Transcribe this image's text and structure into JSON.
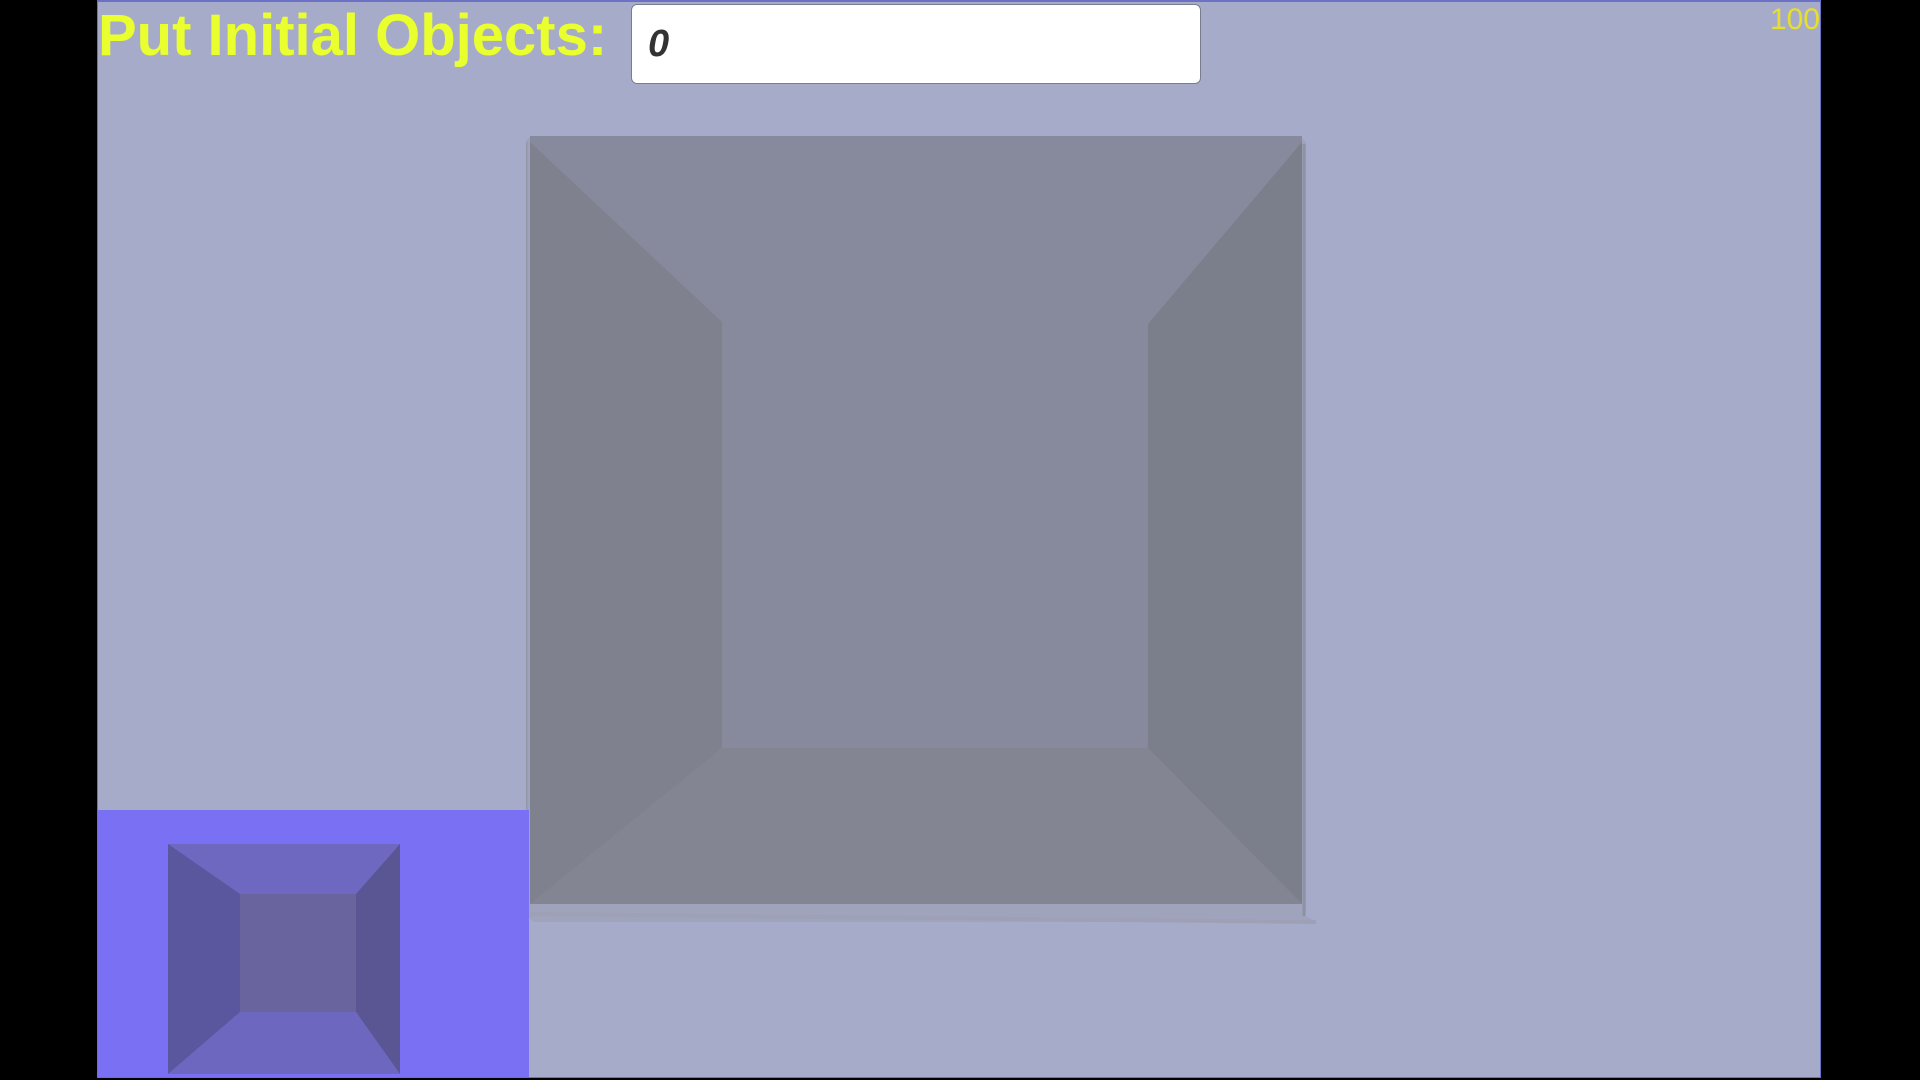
{
  "prompt": {
    "label": "Put Initial Objects:",
    "input_value": "0"
  },
  "hud": {
    "score": "100"
  },
  "colors": {
    "background": "#a7abca",
    "label": "#e9ff2e",
    "score": "#e6e02a",
    "box_back": "#868a9c",
    "box_side": "#7c7e8b",
    "box_floor": "#838592",
    "minimap_bg": "#7970f4"
  }
}
